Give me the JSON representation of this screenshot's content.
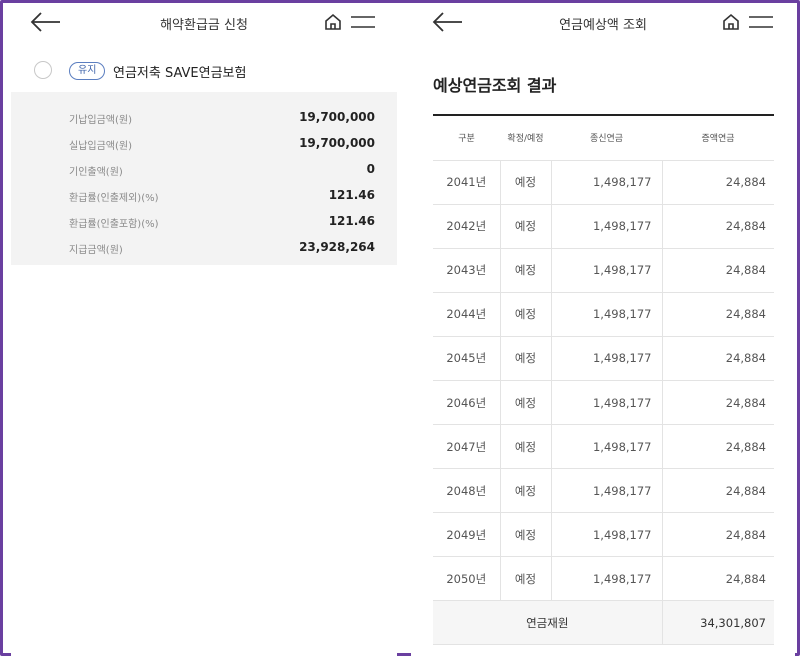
{
  "left": {
    "title": "해약환급금 신청",
    "product": {
      "badge": "유지",
      "name": "연금저축 SAVE연금보험"
    },
    "details": [
      {
        "label": "기납입금액(원)",
        "value": "19,700,000"
      },
      {
        "label": "실납입금액(원)",
        "value": "19,700,000"
      },
      {
        "label": "기인출액(원)",
        "value": "0"
      },
      {
        "label": "환급률(인출제외)(%)",
        "value": "121.46"
      },
      {
        "label": "환급률(인출포함)(%)",
        "value": "121.46"
      },
      {
        "label": "지급금액(원)",
        "value": "23,928,264"
      }
    ]
  },
  "right": {
    "title": "연금예상액 조회",
    "result_title": "예상연금조회 결과",
    "columns": [
      "구분",
      "확정/예정",
      "종신연금",
      "증액연금"
    ],
    "rows": [
      {
        "year": "2041년",
        "status": "예정",
        "life": "1,498,177",
        "inc": "24,884"
      },
      {
        "year": "2042년",
        "status": "예정",
        "life": "1,498,177",
        "inc": "24,884"
      },
      {
        "year": "2043년",
        "status": "예정",
        "life": "1,498,177",
        "inc": "24,884"
      },
      {
        "year": "2044년",
        "status": "예정",
        "life": "1,498,177",
        "inc": "24,884"
      },
      {
        "year": "2045년",
        "status": "예정",
        "life": "1,498,177",
        "inc": "24,884"
      },
      {
        "year": "2046년",
        "status": "예정",
        "life": "1,498,177",
        "inc": "24,884"
      },
      {
        "year": "2047년",
        "status": "예정",
        "life": "1,498,177",
        "inc": "24,884"
      },
      {
        "year": "2048년",
        "status": "예정",
        "life": "1,498,177",
        "inc": "24,884"
      },
      {
        "year": "2049년",
        "status": "예정",
        "life": "1,498,177",
        "inc": "24,884"
      },
      {
        "year": "2050년",
        "status": "예정",
        "life": "1,498,177",
        "inc": "24,884"
      }
    ],
    "total": {
      "label": "연금재원",
      "value": "34,301,807"
    }
  },
  "icons": {
    "back": "arrow-left-icon",
    "home": "home-icon",
    "menu": "hamburger-menu-icon"
  },
  "colors": {
    "frame": "#6a3fa0",
    "badge": "#3f64aa",
    "detail_bg": "#f3f3f3"
  }
}
